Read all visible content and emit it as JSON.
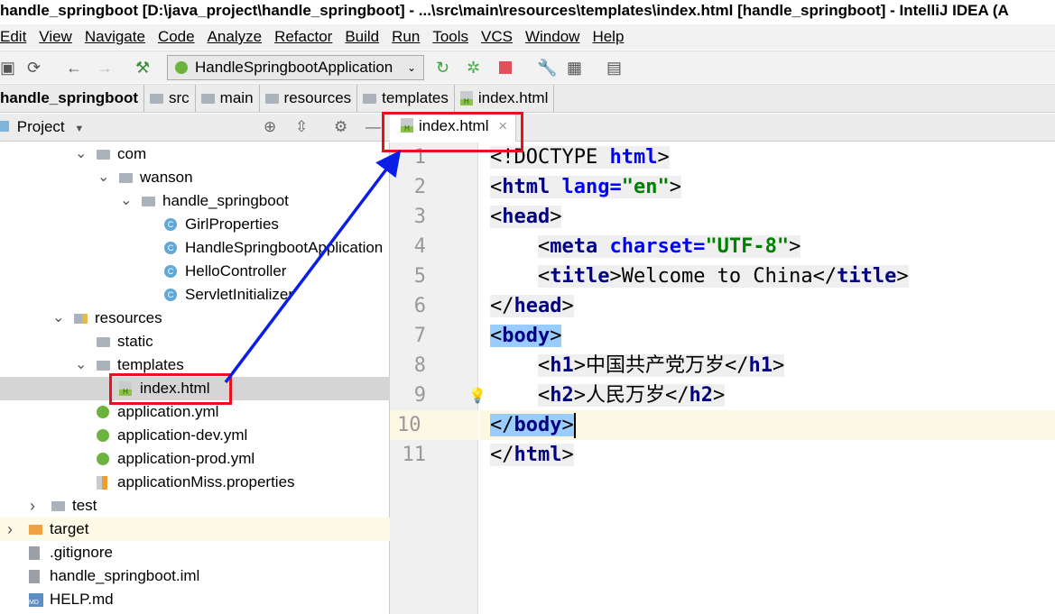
{
  "window": {
    "title": "handle_springboot [D:\\java_project\\handle_springboot] - ...\\src\\main\\resources\\templates\\index.html [handle_springboot] - IntelliJ IDEA (A"
  },
  "menu": [
    "Edit",
    "View",
    "Navigate",
    "Code",
    "Analyze",
    "Refactor",
    "Build",
    "Run",
    "Tools",
    "VCS",
    "Window",
    "Help"
  ],
  "toolbar": {
    "run_config": "HandleSpringbootApplication"
  },
  "breadcrumb": [
    "handle_springboot",
    "src",
    "main",
    "resources",
    "templates",
    "index.html"
  ],
  "project": {
    "title": "Project",
    "tree": [
      {
        "label": "com",
        "level": 3,
        "expanded": true,
        "icon": "folder"
      },
      {
        "label": "wanson",
        "level": 4,
        "expanded": true,
        "icon": "folder"
      },
      {
        "label": "handle_springboot",
        "level": 5,
        "expanded": true,
        "icon": "folder"
      },
      {
        "label": "GirlProperties",
        "level": 6,
        "icon": "class"
      },
      {
        "label": "HandleSpringbootApplication",
        "level": 6,
        "icon": "spring-class"
      },
      {
        "label": "HelloController",
        "level": 6,
        "icon": "class"
      },
      {
        "label": "ServletInitializer",
        "level": 6,
        "icon": "class"
      },
      {
        "label": "resources",
        "level": 2,
        "expanded": true,
        "icon": "resources-folder"
      },
      {
        "label": "static",
        "level": 3,
        "icon": "folder"
      },
      {
        "label": "templates",
        "level": 3,
        "expanded": true,
        "icon": "folder"
      },
      {
        "label": "index.html",
        "level": 4,
        "icon": "html",
        "selected": true
      },
      {
        "label": "application.yml",
        "level": 3,
        "icon": "spring-yml"
      },
      {
        "label": "application-dev.yml",
        "level": 3,
        "icon": "spring-yml"
      },
      {
        "label": "application-prod.yml",
        "level": 3,
        "icon": "spring-yml"
      },
      {
        "label": "applicationMiss.properties",
        "level": 3,
        "icon": "properties"
      },
      {
        "label": "test",
        "level": 1,
        "expanded": false,
        "icon": "folder"
      },
      {
        "label": "target",
        "level": 0,
        "expanded": false,
        "icon": "orange-folder",
        "highlighted": true
      },
      {
        "label": ".gitignore",
        "level": 0,
        "icon": "file"
      },
      {
        "label": "handle_springboot.iml",
        "level": 0,
        "icon": "file"
      },
      {
        "label": "HELP.md",
        "level": 0,
        "icon": "md"
      }
    ]
  },
  "editor": {
    "tab": "index.html",
    "current_line": 10,
    "lines": [
      [
        [
          "pun",
          "<!DOCTYPE "
        ],
        [
          "attr",
          "html"
        ],
        [
          "pun",
          ">"
        ]
      ],
      [
        [
          "pun",
          "<"
        ],
        [
          "tag",
          "html "
        ],
        [
          "attr",
          "lang="
        ],
        [
          "str",
          "\"en\""
        ],
        [
          "pun",
          ">"
        ]
      ],
      [
        [
          "pun",
          "<"
        ],
        [
          "tag",
          "head"
        ],
        [
          "pun",
          ">"
        ]
      ],
      [
        [
          "ind",
          "    "
        ],
        [
          "pun",
          "<"
        ],
        [
          "tag",
          "meta "
        ],
        [
          "attr",
          "charset="
        ],
        [
          "str",
          "\"UTF-8\""
        ],
        [
          "pun",
          ">"
        ]
      ],
      [
        [
          "ind",
          "    "
        ],
        [
          "pun",
          "<"
        ],
        [
          "tag",
          "title"
        ],
        [
          "pun",
          ">"
        ],
        [
          "txt",
          "Welcome to China"
        ],
        [
          "pun",
          "</"
        ],
        [
          "tag",
          "title"
        ],
        [
          "pun",
          ">"
        ]
      ],
      [
        [
          "pun",
          "</"
        ],
        [
          "tag",
          "head"
        ],
        [
          "pun",
          ">"
        ]
      ],
      [
        [
          "bpun",
          "<"
        ],
        [
          "btag",
          "body"
        ],
        [
          "bpun",
          ">"
        ]
      ],
      [
        [
          "ind",
          "    "
        ],
        [
          "pun",
          "<"
        ],
        [
          "tag",
          "h1"
        ],
        [
          "pun",
          ">"
        ],
        [
          "txt",
          "中国共产党万岁"
        ],
        [
          "pun",
          "</"
        ],
        [
          "tag",
          "h1"
        ],
        [
          "pun",
          ">"
        ]
      ],
      [
        [
          "ind",
          "    "
        ],
        [
          "pun",
          "<"
        ],
        [
          "tag",
          "h2"
        ],
        [
          "pun",
          ">"
        ],
        [
          "txt",
          "人民万岁"
        ],
        [
          "pun",
          "</"
        ],
        [
          "tag",
          "h2"
        ],
        [
          "pun",
          ">"
        ]
      ],
      [
        [
          "bpun",
          "</"
        ],
        [
          "btag",
          "body"
        ],
        [
          "bpun",
          ">"
        ]
      ],
      [
        [
          "pun",
          "</"
        ],
        [
          "tag",
          "html"
        ],
        [
          "pun",
          ">"
        ]
      ]
    ]
  },
  "annotation": {
    "box_color": "#e8121b",
    "arrow_color": "#0a1ee6"
  }
}
